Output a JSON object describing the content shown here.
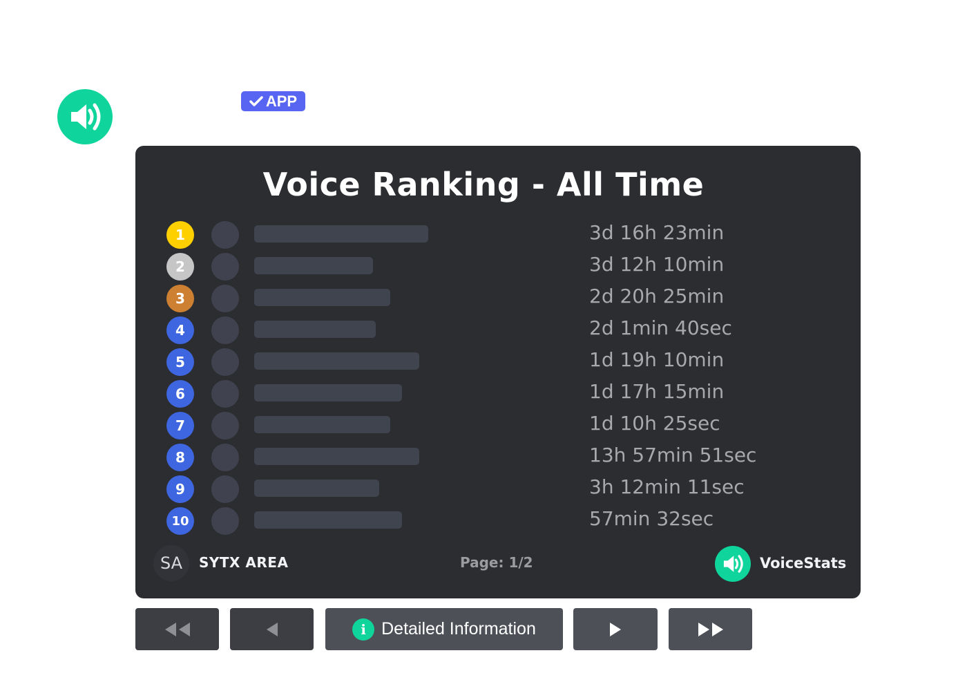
{
  "message": {
    "bot_name": "",
    "bot_avatar_icon": "speaker-icon",
    "badge": {
      "icon": "checkmark-icon",
      "label": "APP",
      "color": "#5865f2"
    }
  },
  "embed": {
    "title": "Voice Ranking - All Time",
    "rows": [
      {
        "rank": "1",
        "rank_color": "#ffd000",
        "name_redacted": true,
        "name_fill": 0.6,
        "time": "3d 16h 23min"
      },
      {
        "rank": "2",
        "rank_color": "#c6c6c6",
        "name_redacted": true,
        "name_fill": 0.41,
        "time": "3d 12h 10min"
      },
      {
        "rank": "3",
        "rank_color": "#cd7f32",
        "name_redacted": true,
        "name_fill": 0.47,
        "time": "2d 20h 25min"
      },
      {
        "rank": "4",
        "rank_color": "#3e66e0",
        "name_redacted": true,
        "name_fill": 0.42,
        "time": "2d 1min 40sec"
      },
      {
        "rank": "5",
        "rank_color": "#3e66e0",
        "name_redacted": true,
        "name_fill": 0.57,
        "time": "1d 19h 10min"
      },
      {
        "rank": "6",
        "rank_color": "#3e66e0",
        "name_redacted": true,
        "name_fill": 0.51,
        "time": "1d 17h 15min"
      },
      {
        "rank": "7",
        "rank_color": "#3e66e0",
        "name_redacted": true,
        "name_fill": 0.47,
        "time": "1d 10h 25sec"
      },
      {
        "rank": "8",
        "rank_color": "#3e66e0",
        "name_redacted": true,
        "name_fill": 0.57,
        "time": "13h 57min 51sec"
      },
      {
        "rank": "9",
        "rank_color": "#3e66e0",
        "name_redacted": true,
        "name_fill": 0.43,
        "time": "3h 12min 11sec"
      },
      {
        "rank": "10",
        "rank_color": "#3e66e0",
        "name_redacted": true,
        "name_fill": 0.51,
        "time": "57min 32sec"
      }
    ],
    "footer": {
      "guild_initials": "SA",
      "guild_name": "SYTX AREA",
      "page": "Page: 1/2",
      "brand_icon": "speaker-icon",
      "brand_name": "VoiceStats"
    }
  },
  "buttons": [
    {
      "id": "first",
      "icon": "double-left-icon",
      "label": "",
      "disabled": true
    },
    {
      "id": "prev",
      "icon": "left-icon",
      "label": "",
      "disabled": true
    },
    {
      "id": "info",
      "icon": "info-icon",
      "label": "Detailed Information",
      "disabled": false
    },
    {
      "id": "next",
      "icon": "right-icon",
      "label": "",
      "disabled": false
    },
    {
      "id": "last",
      "icon": "double-right-icon",
      "label": "",
      "disabled": false
    }
  ],
  "colors": {
    "brand_green": "#0fd59c",
    "card_bg": "#2b2d31",
    "button_bg": "#4e5058",
    "button_disabled_bg": "#3c3e44"
  }
}
